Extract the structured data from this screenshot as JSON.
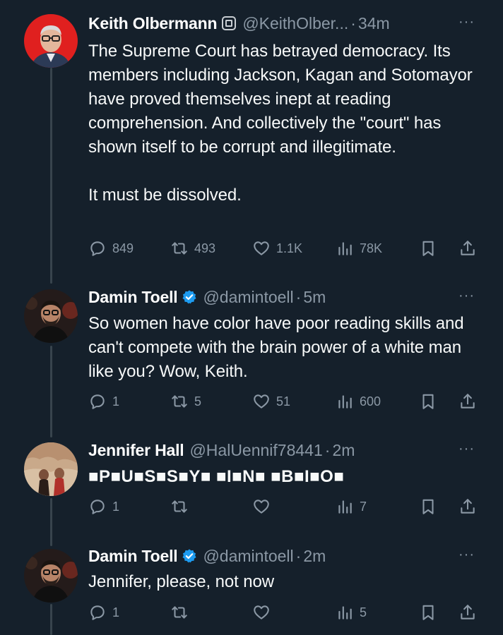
{
  "tweets": [
    {
      "name": "Keith Olbermann",
      "handle": "@KeithOlber...",
      "sep": "·",
      "time": "34m",
      "more": "···",
      "badge": "square-badge-icon",
      "text": "The Supreme Court has betrayed democracy. Its members including Jackson, Kagan and Sotomayor have proved themselves inept at reading comprehension. And collectively the \"court\" has shown itself to be corrupt and illegitimate.\n\nIt must be dissolved.",
      "replies": "849",
      "reposts": "493",
      "likes": "1.1K",
      "views": "78K"
    },
    {
      "name": "Damin Toell",
      "handle": "@damintoell",
      "sep": "·",
      "time": "5m",
      "more": "···",
      "badge": "verified-badge-icon",
      "text": "So women have color have poor reading skills and can't compete with the brain power of a white man like you? Wow, Keith.",
      "replies": "1",
      "reposts": "5",
      "likes": "51",
      "views": "600"
    },
    {
      "name": "Jennifer Hall",
      "handle": "@HalUennif78441",
      "sep": "·",
      "time": "2m",
      "more": "···",
      "text": "■P■U■S■S■Y■ ■I■N■ ■B■I■O■",
      "replies": "1",
      "reposts": "",
      "likes": "",
      "views": "7"
    },
    {
      "name": "Damin Toell",
      "handle": "@damintoell",
      "sep": "·",
      "time": "2m",
      "more": "···",
      "badge": "verified-badge-icon",
      "text": "Jennifer, please, not now",
      "replies": "1",
      "reposts": "",
      "likes": "",
      "views": "5"
    }
  ],
  "colors": {
    "background": "#15202b",
    "text": "#f7f9f9",
    "muted": "#8b98a5",
    "verified": "#1d9bf0",
    "thread_line": "#38444d"
  },
  "icons": [
    "reply-icon",
    "repost-icon",
    "like-icon",
    "views-icon",
    "bookmark-icon",
    "share-icon",
    "more-icon"
  ]
}
